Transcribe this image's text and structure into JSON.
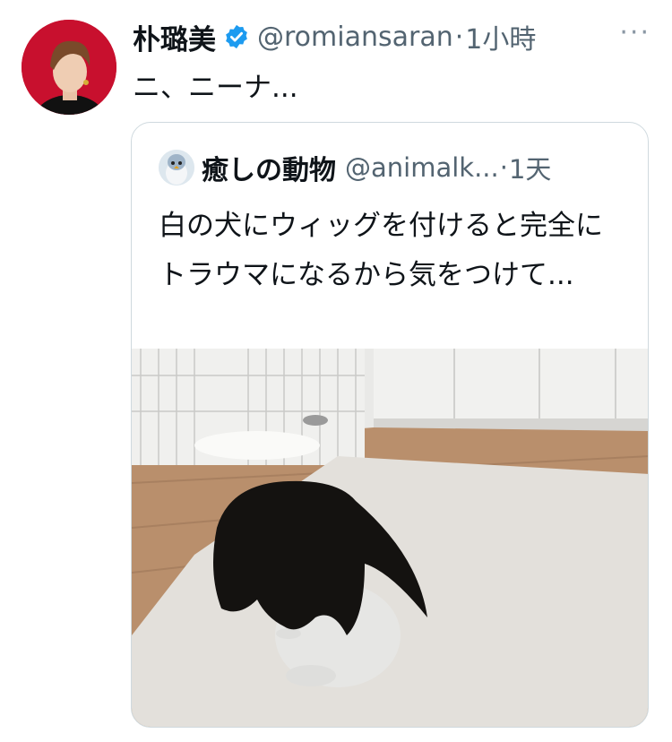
{
  "tweet": {
    "author_name": "朴璐美",
    "author_handle": "@romiansaran",
    "separator": "·",
    "time": "1小時",
    "more": "···",
    "text": "ニ、ニーナ..."
  },
  "quoted": {
    "author_name": "癒しの動物",
    "author_handle": "@animalk...",
    "separator": "·",
    "time": "1天",
    "text": "白の犬にウィッグを付けると完全にトラウマになるから気をつけて..."
  },
  "colors": {
    "verified_badge": "#1d9bf0",
    "secondary_text": "#536471",
    "avatar_background": "#c8102e"
  }
}
